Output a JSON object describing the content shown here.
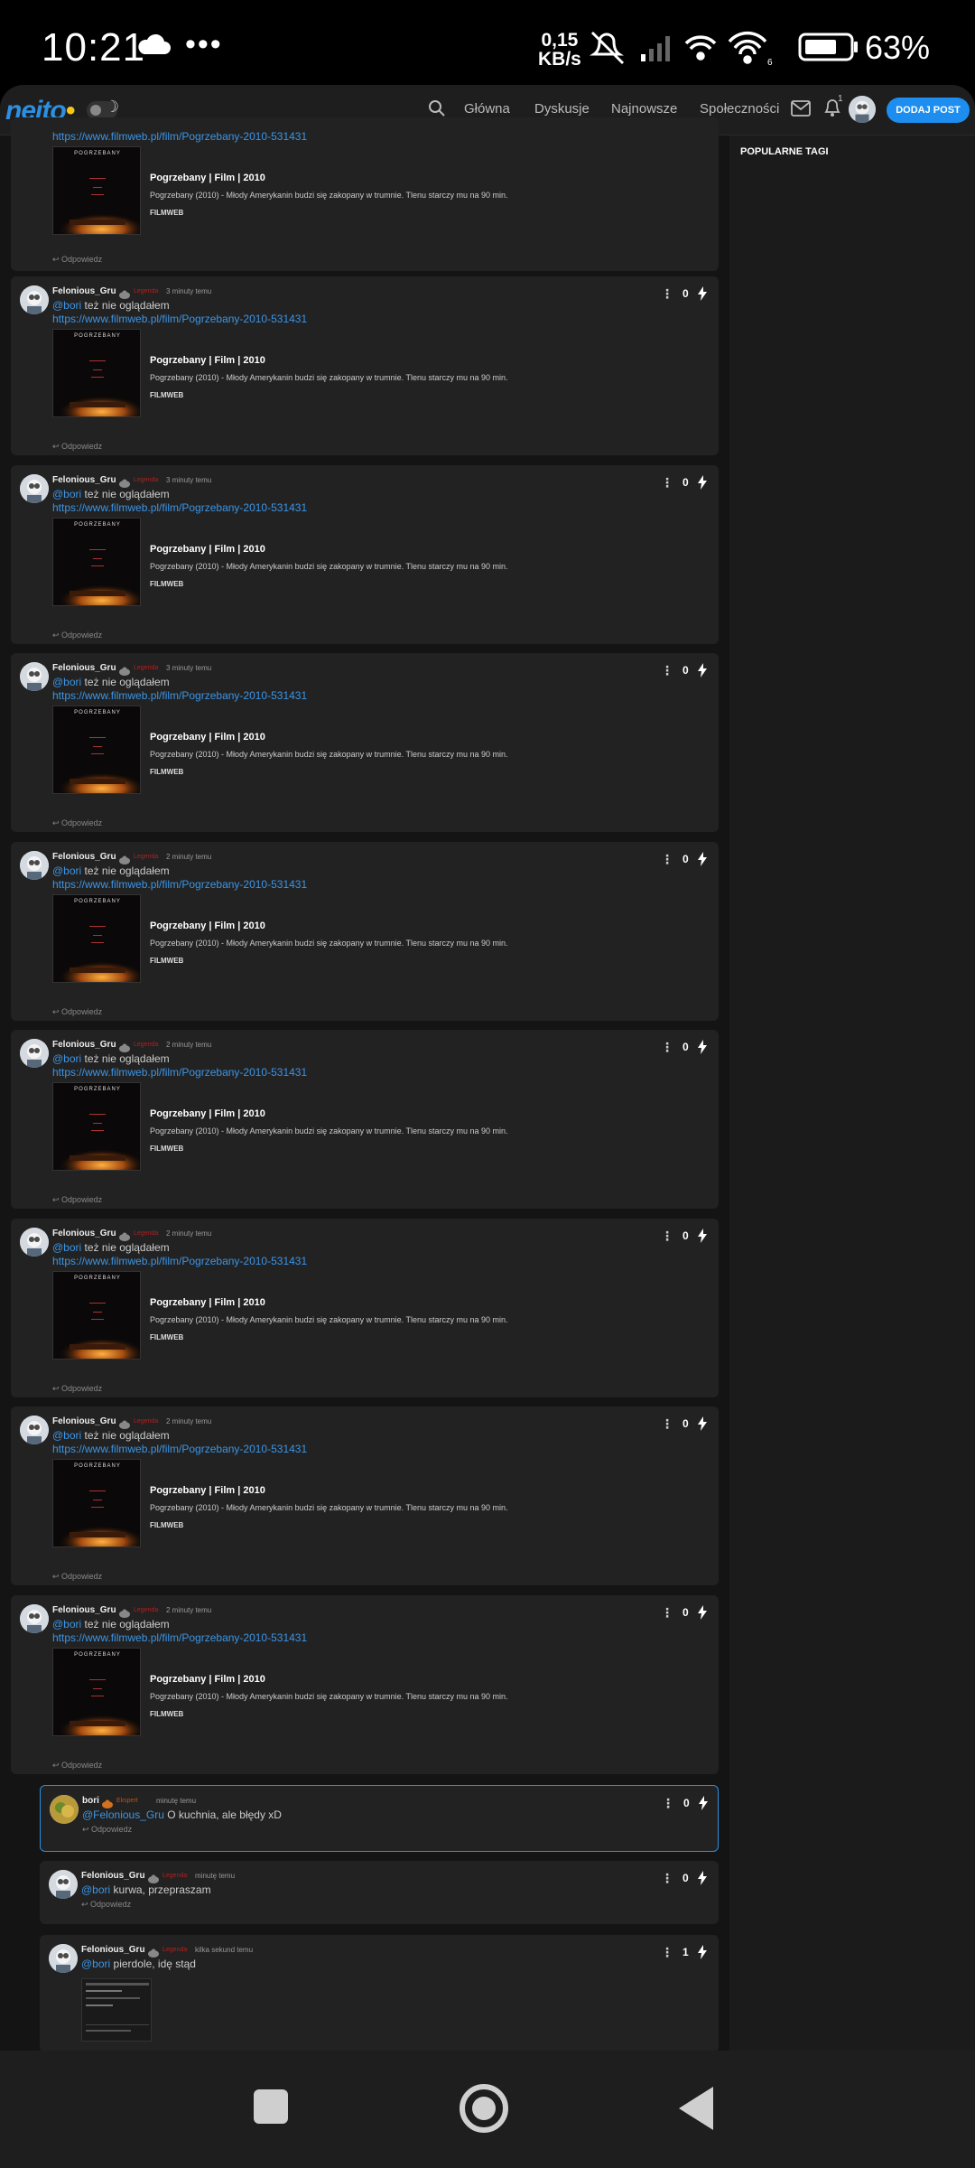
{
  "status_bar": {
    "time": "10:21",
    "speed_value": "0,15",
    "speed_unit": "KB/s",
    "battery": "63%",
    "wifi_badge": "6"
  },
  "navbar": {
    "logo": "nejto",
    "links": [
      "Główna",
      "Dyskusje",
      "Najnowsze",
      "Społeczności"
    ],
    "bell_badge": "1",
    "add_post": "DODAJ POST"
  },
  "sidebar": {
    "title": "POPULARNE TAGI"
  },
  "colors": {
    "accent": "#1d8ef0",
    "link": "#3b95e6",
    "rank": "#b02020",
    "background": "#141414",
    "card": "#222222"
  },
  "embed": {
    "url": "https://www.filmweb.pl/film/Pogrzebany-2010-531431",
    "title": "Pogrzebany | Film | 2010",
    "desc": "Pogrzebany (2010) - Młody Amerykanin budzi się zakopany w trumnie. Tlenu starczy mu na 90 min.",
    "source": "FILMWEB",
    "poster_title": "POGRZEBANY"
  },
  "reply_label": "Odpowiedz",
  "comments": [
    {
      "user": "Felonious_Gru",
      "rank": "Legenda",
      "time": "3 minuty temu",
      "mention": "@bori",
      "text": "też nie oglądałem",
      "votes": "0"
    },
    {
      "user": "Felonious_Gru",
      "rank": "Legenda",
      "time": "3 minuty temu",
      "mention": "@bori",
      "text": "też nie oglądałem",
      "votes": "0"
    },
    {
      "user": "Felonious_Gru",
      "rank": "Legenda",
      "time": "3 minuty temu",
      "mention": "@bori",
      "text": "też nie oglądałem",
      "votes": "0"
    },
    {
      "user": "Felonious_Gru",
      "rank": "Legenda",
      "time": "2 minuty temu",
      "mention": "@bori",
      "text": "też nie oglądałem",
      "votes": "0"
    },
    {
      "user": "Felonious_Gru",
      "rank": "Legenda",
      "time": "2 minuty temu",
      "mention": "@bori",
      "text": "też nie oglądałem",
      "votes": "0"
    },
    {
      "user": "Felonious_Gru",
      "rank": "Legenda",
      "time": "2 minuty temu",
      "mention": "@bori",
      "text": "też nie oglądałem",
      "votes": "0"
    },
    {
      "user": "Felonious_Gru",
      "rank": "Legenda",
      "time": "2 minuty temu",
      "mention": "@bori",
      "text": "też nie oglądałem",
      "votes": "0"
    },
    {
      "user": "Felonious_Gru",
      "rank": "Legenda",
      "time": "2 minuty temu",
      "mention": "@bori",
      "text": "też nie oglądałem",
      "votes": "0"
    }
  ],
  "replies": [
    {
      "user": "bori",
      "rank": "Ekspert",
      "time": "minutę temu",
      "mention": "@Felonious_Gru",
      "text": "O kuchnia, ale błędy xD",
      "votes": "0"
    },
    {
      "user": "Felonious_Gru",
      "rank": "Legenda",
      "time": "minutę temu",
      "mention": "@bori",
      "text": "kurwa, przepraszam",
      "votes": "0"
    },
    {
      "user": "Felonious_Gru",
      "rank": "Legenda",
      "time": "kilka sekund temu",
      "mention": "@bori",
      "text": "pierdole, idę stąd",
      "votes": "1"
    }
  ]
}
